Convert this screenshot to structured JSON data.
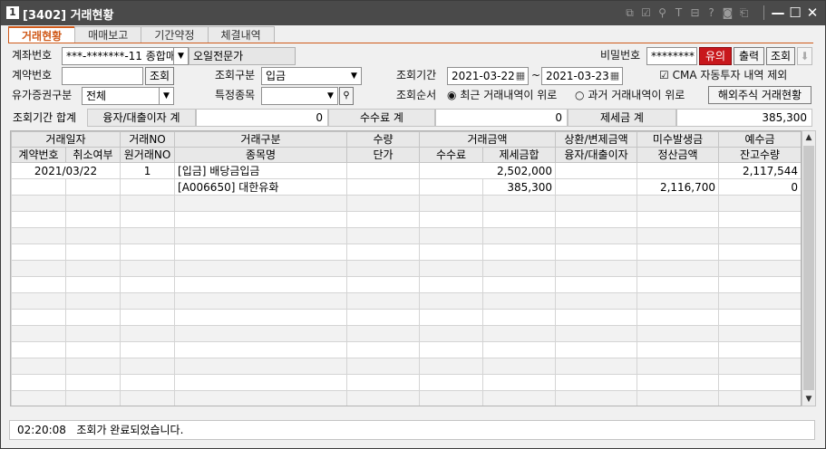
{
  "window": {
    "app_badge": "1",
    "title": "[3402] 거래현황",
    "toolbar_icons": [
      "link-icon",
      "check-icon",
      "pin-icon",
      "font-icon",
      "clipboard-icon",
      "help-icon",
      "camera-icon",
      "screen-icon"
    ],
    "toolbar_glyphs": [
      "⧉",
      "☑",
      "⚲",
      "T",
      "⊟",
      "?",
      "◙",
      "⎗"
    ],
    "min_glyph": "—",
    "max_glyph": "☐",
    "close_glyph": "✕"
  },
  "tabs": [
    {
      "label": "거래현황",
      "active": true
    },
    {
      "label": "매매보고",
      "active": false
    },
    {
      "label": "기간약정",
      "active": false
    },
    {
      "label": "체결내역",
      "active": false
    }
  ],
  "form": {
    "account_label": "계좌번호",
    "account_value": "***-*******-11 종합매",
    "account_name": "오일전문가",
    "password_label": "비밀번호",
    "password_value": "********",
    "notice_button": "유의",
    "print_button": "출력",
    "query_button": "조회",
    "contract_label": "계약번호",
    "contract_value": "",
    "contract_query_button": "조회",
    "query_type_label": "조회구분",
    "query_type_value": "입금",
    "period_label": "조회기간",
    "date_from": "2021-03-22",
    "date_sep": "~",
    "date_to": "2021-03-23",
    "cma_checkbox_label": "CMA 자동투자 내역 제외",
    "cma_checked": true,
    "securities_label": "유가증권구분",
    "securities_value": "전체",
    "specific_label": "특정종목",
    "specific_value": "",
    "order_label": "조회순서",
    "order_option1": "최근 거래내역이 위로",
    "order_option2": "과거 거래내역이 위로",
    "order_selected": "최근 거래내역이 위로",
    "foreign_button": "해외주식 거래현황"
  },
  "summary": {
    "period_total_label": "조회기간 합계",
    "interest_label": "융자/대출이자 계",
    "interest_value": "0",
    "fee_label": "수수료 계",
    "fee_value": "0",
    "tax_label": "제세금 계",
    "tax_value": "385,300"
  },
  "grid": {
    "header_row1": [
      "거래일자",
      "거래NO",
      "거래구분",
      "수량",
      "거래금액",
      "상환/변제금액",
      "미수발생금",
      "예수금"
    ],
    "header_row2": [
      "계약번호",
      "취소여부",
      "원거래NO",
      "종목명",
      "단가",
      "수수료",
      "제세금합",
      "융자/대출이자",
      "정산금액",
      "잔고수량"
    ],
    "rows": [
      [
        "2021/03/22",
        "",
        "1",
        "[입금] 배당금입금",
        "",
        "",
        "2,502,000",
        "",
        "",
        "2,117,544"
      ],
      [
        "",
        "",
        "",
        "[A006650] 대한유화",
        "",
        "",
        "385,300",
        "",
        "2,116,700",
        "0"
      ]
    ],
    "empty_rows": 13
  },
  "status": {
    "time": "02:20:08",
    "message": "조회가 완료되었습니다."
  }
}
